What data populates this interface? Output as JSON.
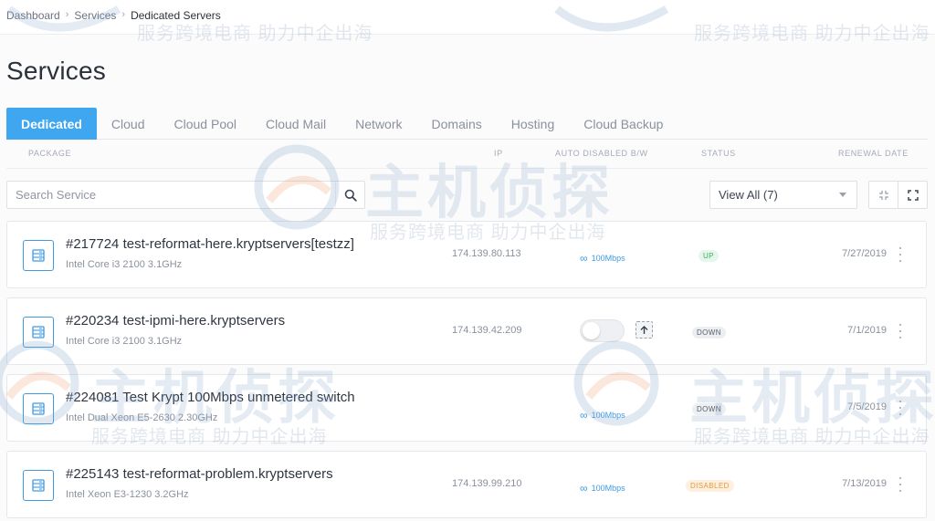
{
  "breadcrumb": {
    "items": [
      "Dashboard",
      "Services",
      "Dedicated Servers"
    ],
    "separator": "›"
  },
  "page_title": "Services",
  "tabs": [
    {
      "label": "Dedicated",
      "active": true
    },
    {
      "label": "Cloud",
      "active": false
    },
    {
      "label": "Cloud Pool",
      "active": false
    },
    {
      "label": "Cloud Mail",
      "active": false
    },
    {
      "label": "Network",
      "active": false
    },
    {
      "label": "Domains",
      "active": false
    },
    {
      "label": "Hosting",
      "active": false
    },
    {
      "label": "Cloud Backup",
      "active": false
    }
  ],
  "columns": {
    "package": "PACKAGE",
    "ip": "IP",
    "auto_disabled_bw": "AUTO DISABLED B/W",
    "status": "STATUS",
    "renewal_date": "RENEWAL DATE"
  },
  "search": {
    "placeholder": "Search Service",
    "value": ""
  },
  "filter": {
    "selected": "View All (7)"
  },
  "services": [
    {
      "name": "#217724 test-reformat-here.kryptservers[testzz]",
      "spec": "Intel Core i3 2100 3.1GHz",
      "ip": "174.139.80.113",
      "bandwidth": "100Mbps",
      "status": "UP",
      "renewal": "7/27/2019"
    },
    {
      "name": "#220234 test-ipmi-here.kryptservers",
      "spec": "Intel Core i3 2100 3.1GHz",
      "ip": "174.139.42.209",
      "bandwidth": "",
      "status": "DOWN",
      "renewal": "7/1/2019"
    },
    {
      "name": "#224081 Test Krypt 100Mbps unmetered switch",
      "spec": "Intel Dual Xeon E5-2630 2.30GHz",
      "ip": "",
      "bandwidth": "100Mbps",
      "status": "DOWN",
      "renewal": "7/5/2019"
    },
    {
      "name": "#225143 test-reformat-problem.kryptservers",
      "spec": "Intel Xeon E3-1230 3.2GHz",
      "ip": "174.139.99.210",
      "bandwidth": "100Mbps",
      "status": "DISABLED",
      "renewal": "7/13/2019"
    }
  ],
  "watermark": {
    "brand": "主机侦探",
    "slogan": "服务跨境电商 助力中企出海"
  },
  "colors": {
    "accent": "#3fa7ef",
    "status_up": "#3daf62",
    "status_down": "#5a616c",
    "status_disabled": "#e99a35"
  }
}
